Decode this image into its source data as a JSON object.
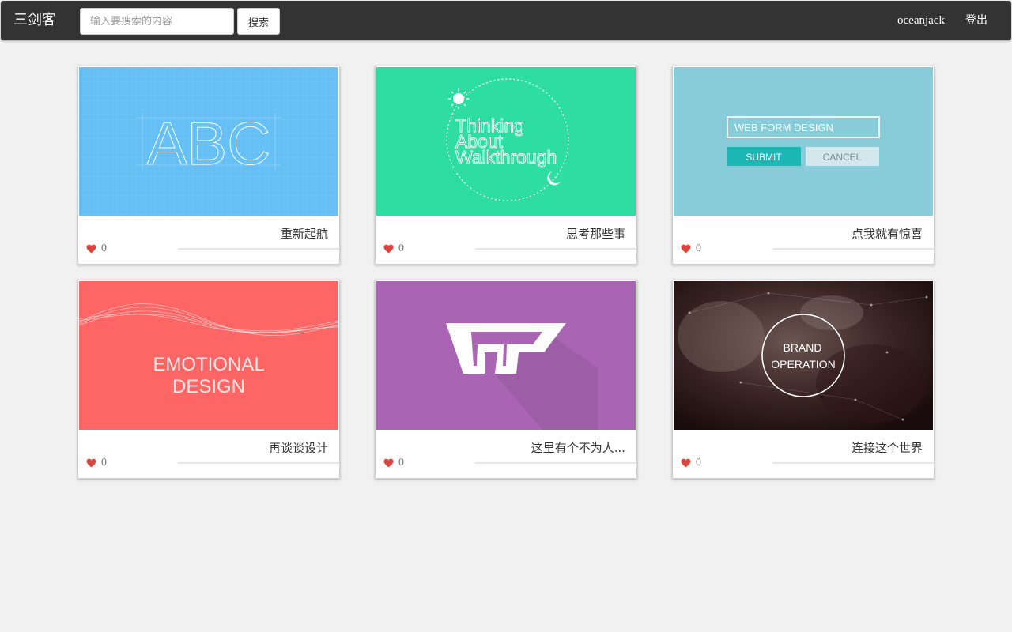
{
  "header": {
    "brand": "三剑客",
    "search_placeholder": "输入要搜索的内容",
    "search_button": "搜索",
    "username": "oceanjack",
    "logout": "登出"
  },
  "cards": [
    {
      "title": "重新起航",
      "likes": "0",
      "thumbnail": {
        "text": "ABC",
        "bg": "#64bff5"
      }
    },
    {
      "title": "思考那些事",
      "likes": "0",
      "thumbnail": {
        "line1": "Thinking",
        "line2": "About",
        "line3": "Walkthrough",
        "bg": "#2ddda1"
      }
    },
    {
      "title": "点我就有惊喜",
      "likes": "0",
      "thumbnail": {
        "field": "WEB FORM DESIGN",
        "submit": "SUBMIT",
        "cancel": "CANCEL",
        "bg": "#88cbd9"
      }
    },
    {
      "title": "再谈谈设计",
      "likes": "0",
      "thumbnail": {
        "line1": "EMOTIONAL",
        "line2": "DESIGN",
        "bg": "#fe6565"
      }
    },
    {
      "title": "这里有个不为人...",
      "likes": "0",
      "thumbnail": {
        "bg": "#a965b4"
      }
    },
    {
      "title": "连接这个世界",
      "likes": "0",
      "thumbnail": {
        "line1": "BRAND",
        "line2": "OPERATION",
        "bg": "#2a1a1a"
      }
    }
  ],
  "colors": {
    "navbar": "#333333",
    "page_bg": "#f1f1f1",
    "heart": "#d9443f"
  },
  "icons": {
    "like": "heart-icon"
  }
}
